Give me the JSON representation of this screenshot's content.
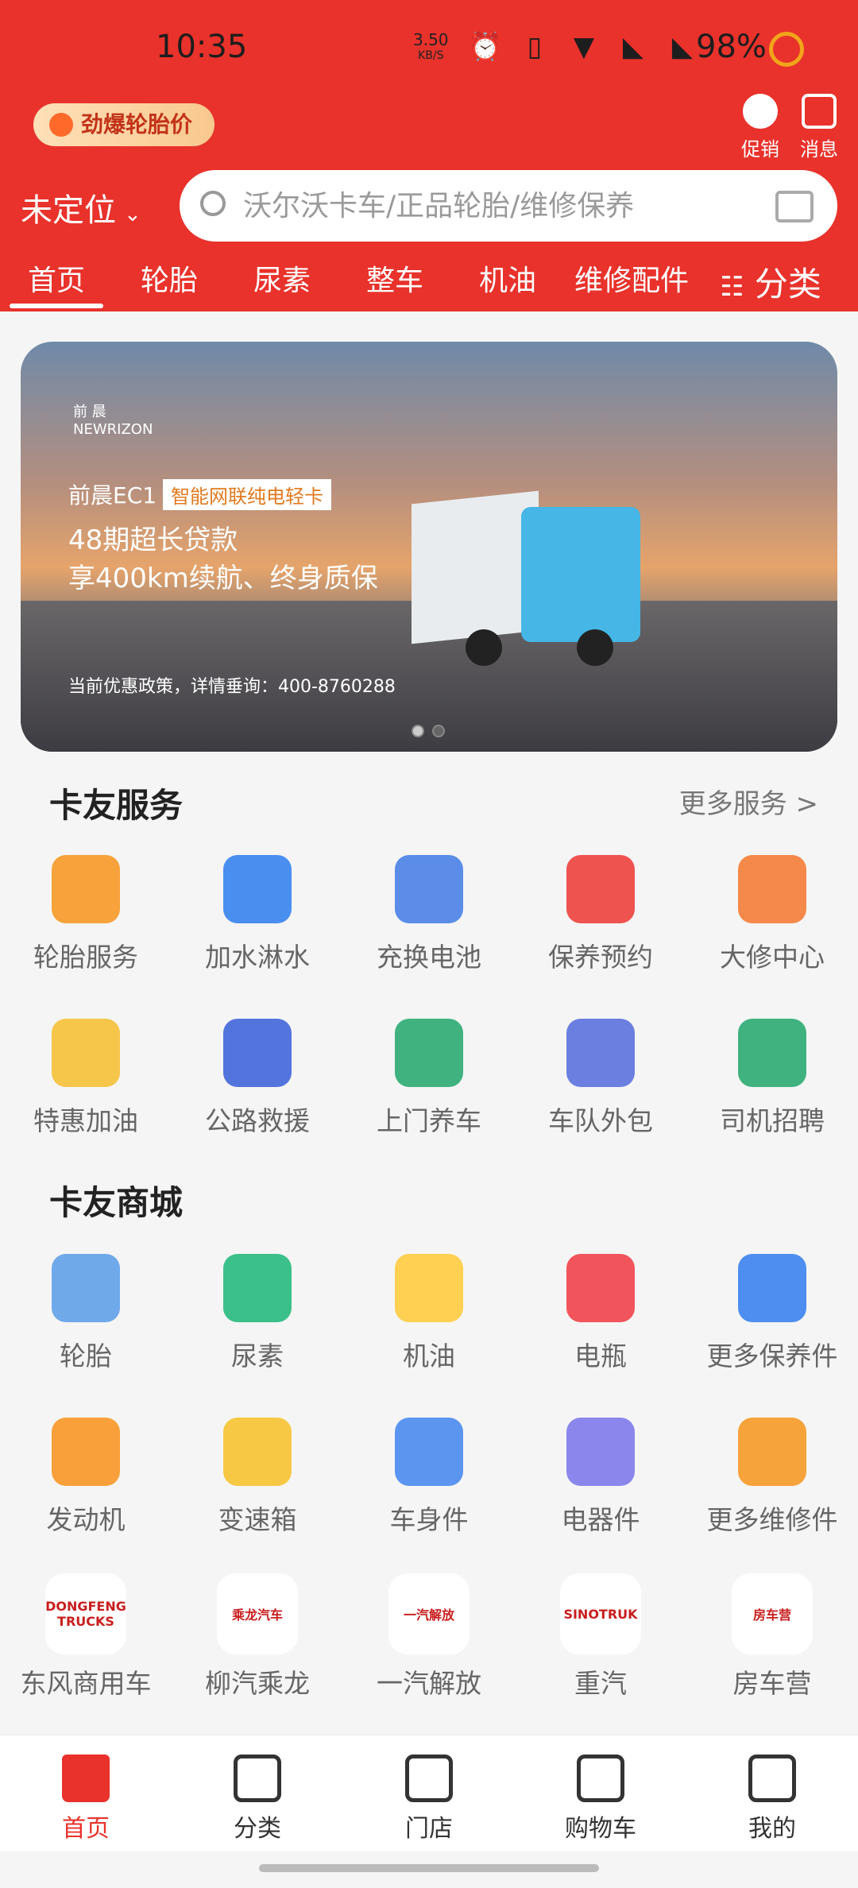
{
  "status_bar": {
    "time": "10:35",
    "speed_value": "3.50",
    "speed_unit": "KB/S",
    "battery": "98%"
  },
  "header": {
    "promo_pill": "劲爆轮胎价",
    "actions": [
      {
        "label": "促销",
        "icon": "discount-icon"
      },
      {
        "label": "消息",
        "icon": "message-icon"
      }
    ],
    "location": "未定位",
    "search_placeholder": "沃尔沃卡车/正品轮胎/维修保养"
  },
  "tabs": [
    "首页",
    "轮胎",
    "尿素",
    "整车",
    "机油",
    "维修配件"
  ],
  "category_tab": "分类",
  "banner": {
    "brand_cn": "前 晨",
    "brand_en": "NEWRIZON",
    "model": "前晨EC1",
    "tag": "智能网联纯电轻卡",
    "line1": "48期超长贷款",
    "line2": "享400km续航、终身质保",
    "contact": "当前优惠政策，详情垂询：400-8760288",
    "page_count": 2,
    "active_page": 2
  },
  "services": {
    "title": "卡友服务",
    "more": "更多服务 >",
    "items": [
      {
        "label": "轮胎服务",
        "color": "#f7a23b"
      },
      {
        "label": "加水淋水",
        "color": "#4a8ff0"
      },
      {
        "label": "充换电池",
        "color": "#5b8de8"
      },
      {
        "label": "保养预约",
        "color": "#ef5350"
      },
      {
        "label": "大修中心",
        "color": "#f5894a"
      },
      {
        "label": "特惠加油",
        "color": "#f6c64b"
      },
      {
        "label": "公路救援",
        "color": "#5474dd"
      },
      {
        "label": "上门养车",
        "color": "#3fb27f"
      },
      {
        "label": "车队外包",
        "color": "#6a7fe0"
      },
      {
        "label": "司机招聘",
        "color": "#3fb27f"
      }
    ]
  },
  "mall": {
    "title": "卡友商城",
    "items": [
      {
        "label": "轮胎",
        "color": "#6fa9ea"
      },
      {
        "label": "尿素",
        "color": "#3cc08a"
      },
      {
        "label": "机油",
        "color": "#ffd052"
      },
      {
        "label": "电瓶",
        "color": "#f2545b"
      },
      {
        "label": "更多保养件",
        "color": "#4d8ef0"
      },
      {
        "label": "发动机",
        "color": "#f9a03a"
      },
      {
        "label": "变速箱",
        "color": "#f7c844"
      },
      {
        "label": "车身件",
        "color": "#5b95f0"
      },
      {
        "label": "电器件",
        "color": "#8a86ec"
      },
      {
        "label": "更多维修件",
        "color": "#f7a33b"
      }
    ],
    "brands": [
      {
        "label": "东风商用车",
        "logo": "DONGFENG TRUCKS"
      },
      {
        "label": "柳汽乘龙",
        "logo": "乘龙汽车"
      },
      {
        "label": "一汽解放",
        "logo": "一汽解放"
      },
      {
        "label": "重汽",
        "logo": "SINOTRUK"
      },
      {
        "label": "房车营",
        "logo": "房车营"
      }
    ]
  },
  "bottom_nav": [
    {
      "label": "首页",
      "icon": "home-icon"
    },
    {
      "label": "分类",
      "icon": "grid-icon"
    },
    {
      "label": "门店",
      "icon": "store-icon"
    },
    {
      "label": "购物车",
      "icon": "cart-icon"
    },
    {
      "label": "我的",
      "icon": "profile-icon"
    }
  ]
}
